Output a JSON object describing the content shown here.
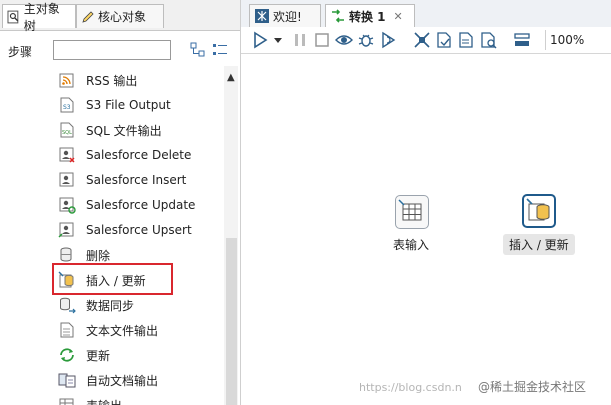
{
  "left_panel": {
    "tabs": [
      {
        "label": "主对象树",
        "icon": "search-tree-icon"
      },
      {
        "label": "核心对象",
        "icon": "pencil-icon"
      }
    ],
    "steps_label": "步骤",
    "search": {
      "value": "",
      "placeholder": ""
    },
    "toolbar_icons": [
      "expand-all-icon",
      "collapse-all-icon"
    ],
    "items": [
      {
        "label": "RSS 输出",
        "icon": "rss-output-icon"
      },
      {
        "label": "S3 File Output",
        "icon": "s3-output-icon"
      },
      {
        "label": "SQL 文件输出",
        "icon": "sql-output-icon"
      },
      {
        "label": "Salesforce Delete",
        "icon": "salesforce-delete-icon"
      },
      {
        "label": "Salesforce Insert",
        "icon": "salesforce-insert-icon"
      },
      {
        "label": "Salesforce Update",
        "icon": "salesforce-update-icon"
      },
      {
        "label": "Salesforce Upsert",
        "icon": "salesforce-upsert-icon"
      },
      {
        "label": "删除",
        "icon": "delete-db-icon"
      },
      {
        "label": "插入 / 更新",
        "icon": "insert-update-icon",
        "selected": true
      },
      {
        "label": "数据同步",
        "icon": "sync-icon"
      },
      {
        "label": "文本文件输出",
        "icon": "text-file-output-icon"
      },
      {
        "label": "更新",
        "icon": "refresh-icon"
      },
      {
        "label": "自动文档输出",
        "icon": "auto-doc-icon"
      },
      {
        "label": "表输出",
        "icon": "table-output-icon"
      }
    ]
  },
  "editor": {
    "tabs": [
      {
        "label": "欢迎!",
        "icon": "kettle-icon"
      },
      {
        "label": "转换 1",
        "icon": "transformation-icon",
        "close": "✕",
        "active": true
      }
    ],
    "toolbar": {
      "icons": [
        "run-icon",
        "run-dropdown-icon",
        "pause-icon",
        "stop-icon",
        "preview-icon",
        "debug-icon",
        "replay-icon",
        "verify-icon",
        "impact-icon",
        "sql-icon",
        "explore-db-icon",
        "show-results-icon"
      ],
      "zoom": "100%"
    },
    "canvas": {
      "nodes": [
        {
          "label": "表输入",
          "icon": "table-input-icon",
          "active": false
        },
        {
          "label": "插入 / 更新",
          "icon": "insert-update-icon",
          "active": true
        }
      ],
      "watermark_url": "https://blog.csdn.n",
      "watermark_brand": "@稀土掘金技术社区"
    }
  }
}
